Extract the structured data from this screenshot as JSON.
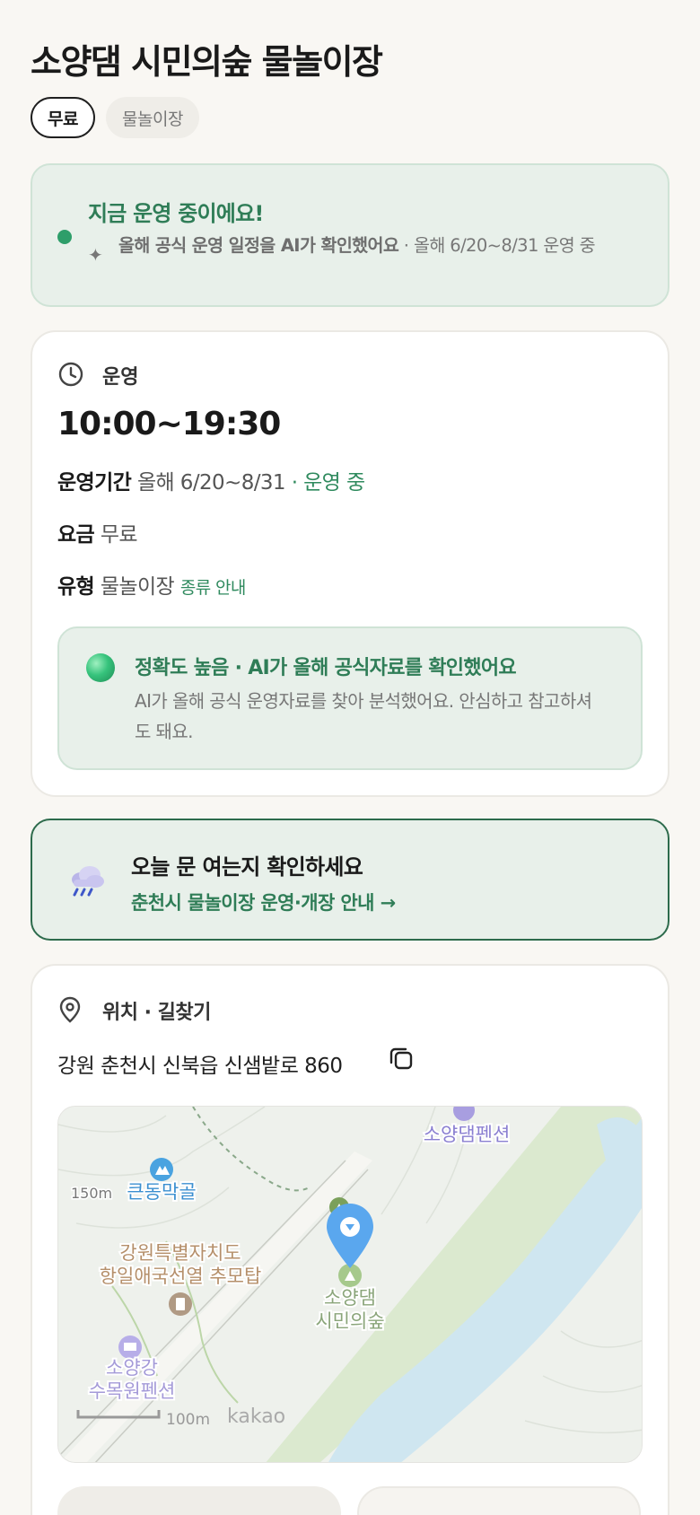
{
  "header": {
    "title": "소양댐 시민의숲 물놀이장"
  },
  "chips": {
    "fee": "무료",
    "type": "물놀이장"
  },
  "status": {
    "title": "지금 운영 중이에요!",
    "ai_note": "올해 공식 운영 일정을 AI가 확인했어요",
    "period": " · 올해 6/20~8/31 운영 중"
  },
  "operation": {
    "section_label": "운영",
    "hours": "10:00~19:30",
    "period_label": "운영기간",
    "period_value": "올해 6/20~8/31",
    "period_status": " · 운영 중",
    "fee_label": "요금",
    "fee_value": "무료",
    "type_label": "유형",
    "type_value": "물놀이장",
    "type_link": "종류 안내",
    "accuracy_title": "정확도 높음 · AI가 올해 공식자료를 확인했어요",
    "accuracy_desc": "AI가 올해 공식 운영자료를 찾아 분석했어요. 안심하고 참고하셔도 돼요."
  },
  "notice": {
    "title": "오늘 문 여는지 확인하세요",
    "link": "춘천시 물놀이장 운영·개장 안내 →"
  },
  "location": {
    "section_label": "위치 · 길찾기",
    "address": "강원 춘천시 신북읍 신샘밭로 860"
  },
  "map": {
    "label_pension_top": "소양댐펜션",
    "label_peak": "큰동막골",
    "label_elevation": "150m",
    "label_monument_1": "강원특별자치도",
    "label_monument_2": "항일애국선열 추모탑",
    "label_target_1": "소양댐",
    "label_target_2": "시민의숲",
    "label_pension_bottom_1": "소양강",
    "label_pension_bottom_2": "수목원펜션",
    "scale": "100m",
    "brand": "kakao"
  },
  "colors": {
    "accent_green": "#2f7d57",
    "status_bg": "#e8f0ea",
    "river": "#cfe6f0",
    "marker": "#5aa7ee"
  }
}
